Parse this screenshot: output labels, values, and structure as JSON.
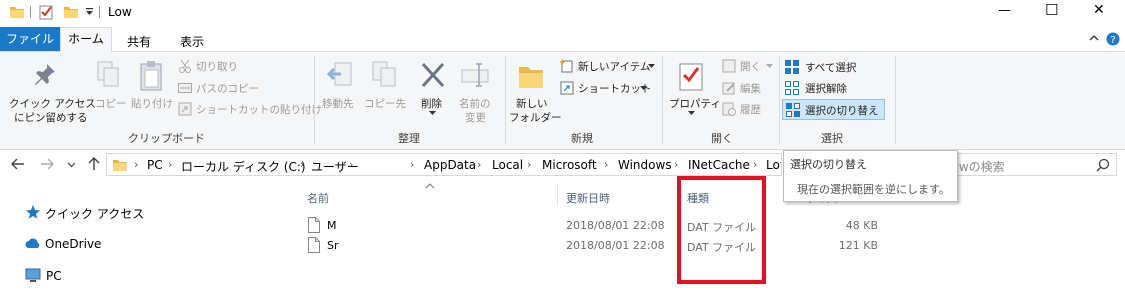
{
  "window": {
    "title": "Low",
    "minimize_glyph": "—",
    "maximize_glyph": "☐",
    "close_glyph": "✕"
  },
  "tabs": {
    "file": "ファイル",
    "home": "ホーム",
    "share": "共有",
    "view": "表示"
  },
  "ribbon": {
    "clipboard": {
      "pin_line1": "クイック アクセス",
      "pin_line2": "にピン留めする",
      "copy": "コピー",
      "paste": "貼り付け",
      "cut": "切り取り",
      "copy_path": "パスのコピー",
      "paste_shortcut": "ショートカットの貼り付け",
      "group": "クリップボード"
    },
    "organize": {
      "move_to": "移動先",
      "copy_to": "コピー先",
      "delete": "削除",
      "rename_line1": "名前の",
      "rename_line2": "変更",
      "group": "整理"
    },
    "new": {
      "folder_line1": "新しい",
      "folder_line2": "フォルダー",
      "new_item": "新しいアイテム",
      "easy_access": "ショートカット",
      "group": "新規"
    },
    "open": {
      "properties": "プロパティ",
      "open": "開く",
      "edit": "編集",
      "history": "履歴",
      "group": "開く"
    },
    "select": {
      "select_all": "すべて選択",
      "select_none": "選択解除",
      "invert": "選択の切り替え",
      "group": "選択"
    }
  },
  "address": {
    "crumbs": [
      "PC",
      "ローカル ディスク (C:)",
      "ユーザー",
      "",
      "AppData",
      "Local",
      "Microsoft",
      "Windows",
      "INetCache",
      "Low"
    ],
    "search_placeholder": "Lowの検索"
  },
  "tooltip": {
    "title": "選択の切り替え",
    "body": "現在の選択範囲を逆にします。"
  },
  "nav": [
    {
      "label": "クイック アクセス"
    },
    {
      "label": "OneDrive"
    },
    {
      "label": "PC"
    }
  ],
  "columns": {
    "name": "名前",
    "date": "更新日時",
    "type": "種類",
    "size": "サイズ"
  },
  "files": [
    {
      "name": "M",
      "date": "2018/08/01 22:08",
      "type": "DAT ファイル",
      "size": "48 KB"
    },
    {
      "name": "Sr",
      "date": "2018/08/01 22:08",
      "type": "DAT ファイル",
      "size": "121 KB"
    }
  ],
  "colors": {
    "accent": "#1979ca",
    "highlight": "#e81123"
  }
}
